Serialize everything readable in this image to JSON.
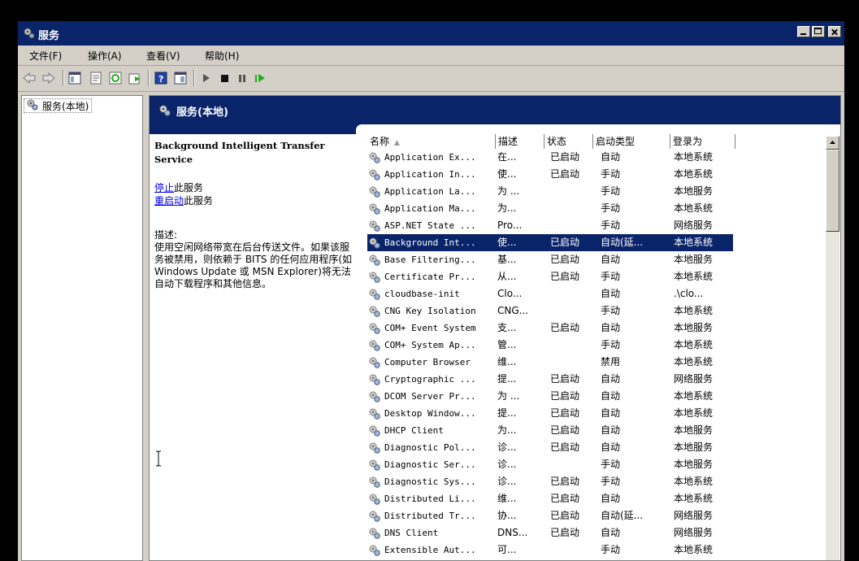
{
  "window": {
    "title": "服务"
  },
  "menu": {
    "items": [
      "文件(F)",
      "操作(A)",
      "查看(V)",
      "帮助(H)"
    ]
  },
  "toolbar": {
    "icons": [
      "back-arrow-icon",
      "forward-arrow-icon",
      "show-hide-tree-icon",
      "properties-icon",
      "refresh-icon",
      "export-list-icon",
      "help-icon",
      "view-icon",
      "start-service-icon",
      "stop-service-icon",
      "pause-service-icon",
      "resume-service-icon"
    ]
  },
  "tree": {
    "root_label": "服务(本地)"
  },
  "detail": {
    "header_title": "服务(本地)",
    "service_title": "Background Intelligent Transfer Service",
    "stop_link": "停止",
    "stop_suffix": "此服务",
    "restart_link": "重启动",
    "restart_suffix": "此服务",
    "desc_label": "描述:",
    "desc_text": "使用空闲网络带宽在后台传送文件。如果该服务被禁用，则依赖于 BITS 的任何应用程序(如 Windows Update 或 MSN Explorer)将无法自动下载程序和其他信息。"
  },
  "list": {
    "headers": {
      "name": "名称",
      "desc": "描述",
      "status": "状态",
      "start": "启动类型",
      "logon": "登录为"
    },
    "rows": [
      {
        "name": "Application Ex...",
        "desc": "在...",
        "status": "已启动",
        "start": "自动",
        "logon": "本地系统"
      },
      {
        "name": "Application In...",
        "desc": "使...",
        "status": "已启动",
        "start": "手动",
        "logon": "本地系统"
      },
      {
        "name": "Application La...",
        "desc": "为 ...",
        "status": "",
        "start": "手动",
        "logon": "本地服务"
      },
      {
        "name": "Application Ma...",
        "desc": "为...",
        "status": "",
        "start": "手动",
        "logon": "本地系统"
      },
      {
        "name": "ASP.NET State ...",
        "desc": "Pro...",
        "status": "",
        "start": "手动",
        "logon": "网络服务"
      },
      {
        "name": "Background Int...",
        "desc": "使...",
        "status": "已启动",
        "start": "自动(延...",
        "logon": "本地系统",
        "selected": true
      },
      {
        "name": "Base Filtering...",
        "desc": "基...",
        "status": "已启动",
        "start": "自动",
        "logon": "本地服务"
      },
      {
        "name": "Certificate Pr...",
        "desc": "从...",
        "status": "已启动",
        "start": "手动",
        "logon": "本地系统"
      },
      {
        "name": "cloudbase-init",
        "desc": "Clo...",
        "status": "",
        "start": "自动",
        "logon": ".\\clo..."
      },
      {
        "name": "CNG Key Isolation",
        "desc": "CNG...",
        "status": "",
        "start": "手动",
        "logon": "本地系统"
      },
      {
        "name": "COM+ Event System",
        "desc": "支...",
        "status": "已启动",
        "start": "自动",
        "logon": "本地服务"
      },
      {
        "name": "COM+ System Ap...",
        "desc": "管...",
        "status": "",
        "start": "手动",
        "logon": "本地系统"
      },
      {
        "name": "Computer Browser",
        "desc": "维...",
        "status": "",
        "start": "禁用",
        "logon": "本地系统"
      },
      {
        "name": "Cryptographic ...",
        "desc": "提...",
        "status": "已启动",
        "start": "自动",
        "logon": "网络服务"
      },
      {
        "name": "DCOM Server Pr...",
        "desc": "为 ...",
        "status": "已启动",
        "start": "自动",
        "logon": "本地系统"
      },
      {
        "name": "Desktop Window...",
        "desc": "提...",
        "status": "已启动",
        "start": "自动",
        "logon": "本地系统"
      },
      {
        "name": "DHCP Client",
        "desc": "为...",
        "status": "已启动",
        "start": "自动",
        "logon": "本地服务"
      },
      {
        "name": "Diagnostic Pol...",
        "desc": "诊...",
        "status": "已启动",
        "start": "自动",
        "logon": "本地服务"
      },
      {
        "name": "Diagnostic Ser...",
        "desc": "诊...",
        "status": "",
        "start": "手动",
        "logon": "本地服务"
      },
      {
        "name": "Diagnostic Sys...",
        "desc": "诊...",
        "status": "已启动",
        "start": "手动",
        "logon": "本地系统"
      },
      {
        "name": "Distributed Li...",
        "desc": "维...",
        "status": "已启动",
        "start": "自动",
        "logon": "本地系统"
      },
      {
        "name": "Distributed Tr...",
        "desc": "协...",
        "status": "已启动",
        "start": "自动(延...",
        "logon": "网络服务"
      },
      {
        "name": "DNS Client",
        "desc": "DNS...",
        "status": "已启动",
        "start": "自动",
        "logon": "网络服务"
      },
      {
        "name": "Extensible Aut...",
        "desc": "可...",
        "status": "",
        "start": "手动",
        "logon": "本地系统"
      }
    ]
  }
}
